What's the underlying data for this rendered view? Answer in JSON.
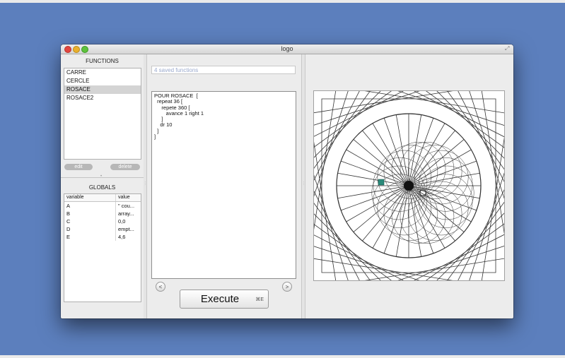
{
  "window": {
    "title": "logo"
  },
  "functions_panel": {
    "title": "FUNCTIONS",
    "items": [
      {
        "label": "CARRE",
        "selected": false
      },
      {
        "label": "CERCLE",
        "selected": false
      },
      {
        "label": "ROSACE",
        "selected": true
      },
      {
        "label": "ROSACE2",
        "selected": false
      }
    ],
    "edit_label": "edit",
    "delete_label": "delete"
  },
  "globals_panel": {
    "title": "GLOBALS",
    "columns": [
      "variable",
      "value"
    ],
    "rows": [
      {
        "variable": "A",
        "value": "\" cou..."
      },
      {
        "variable": "B",
        "value": "array..."
      },
      {
        "variable": "C",
        "value": "0,0"
      },
      {
        "variable": "D",
        "value": "empt..."
      },
      {
        "variable": "E",
        "value": "4,6"
      }
    ]
  },
  "editor": {
    "saved_placeholder": "4 saved functions",
    "code_lines": [
      "POUR ROSACE  [",
      "  repeat 36 [",
      "     repete 360 [",
      "        avance 1 right 1",
      "     ]",
      "    dr 10",
      "  ]",
      "]"
    ],
    "prev_icon": "chevron-left-icon",
    "next_icon": "chevron-right-icon",
    "prev_glyph": "<",
    "next_glyph": ">",
    "execute_label": "Execute",
    "execute_shortcut": "⌘E"
  },
  "colors": {
    "desktop": "#5c7fbd",
    "turtle": "#2a8a7a",
    "stroke": "#333333"
  }
}
